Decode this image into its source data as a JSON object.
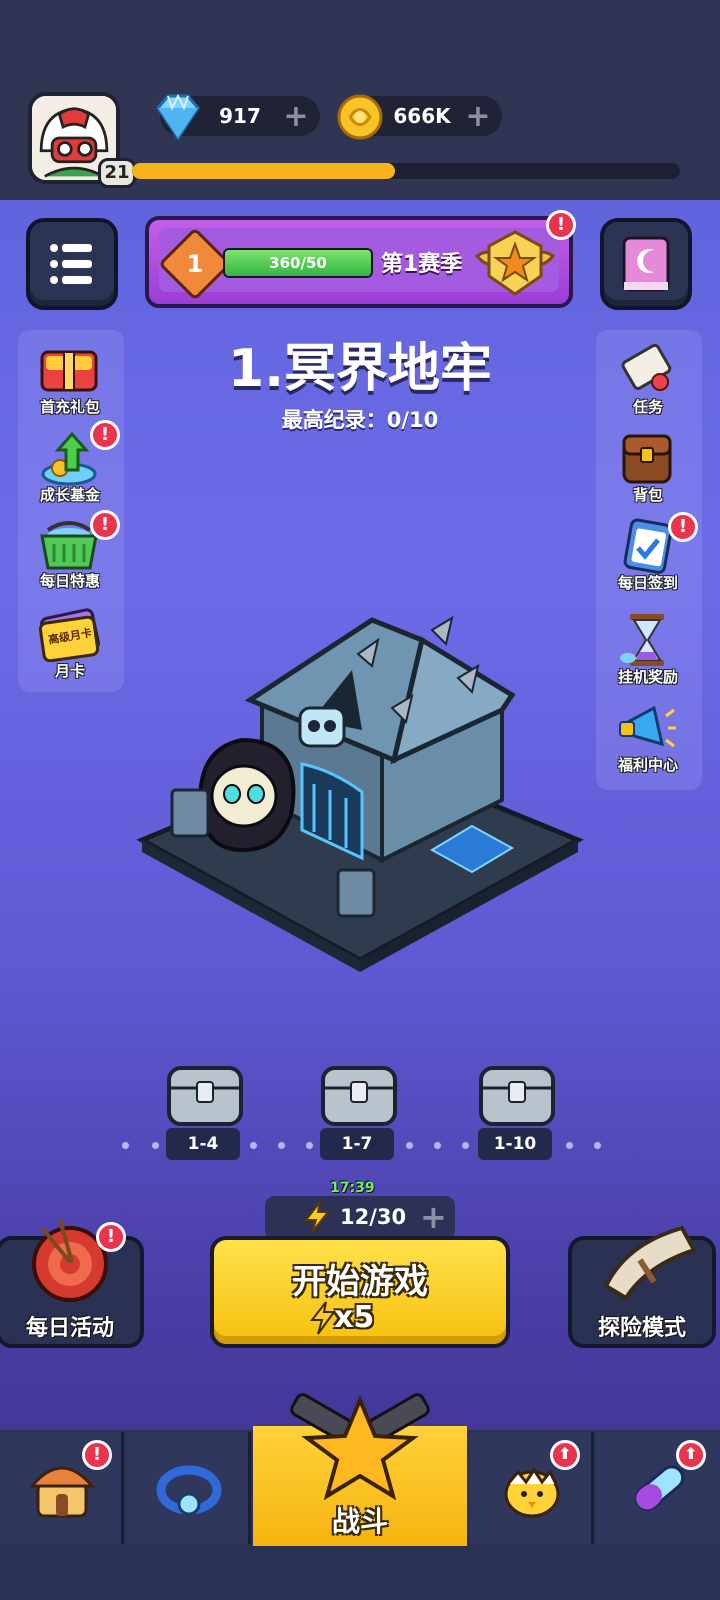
{
  "header": {
    "player_level": "21",
    "xp_progress_fraction": 0.48,
    "gems": "917",
    "coins": "666K",
    "plus_symbol": "+"
  },
  "season": {
    "rank": "1",
    "progress_text": "360/50",
    "label": "第1赛季",
    "alert": "!"
  },
  "stage": {
    "title": "1.冥界地牢",
    "record": "最高纪录：0/10"
  },
  "left_menu": [
    {
      "label": "首充礼包",
      "icon": "gift-box-icon"
    },
    {
      "label": "成长基金",
      "icon": "growth-fund-icon",
      "alert": "!"
    },
    {
      "label": "每日特惠",
      "icon": "basket-icon",
      "alert": "!"
    },
    {
      "label": "月卡",
      "icon": "monthly-card-icon",
      "tag": "高级月卡"
    }
  ],
  "right_menu": [
    {
      "label": "任务",
      "icon": "scroll-icon"
    },
    {
      "label": "背包",
      "icon": "backpack-icon"
    },
    {
      "label": "每日签到",
      "icon": "checkin-clipboard-icon",
      "alert": "!"
    },
    {
      "label": "挂机奖励",
      "icon": "hourglass-icon"
    },
    {
      "label": "福利中心",
      "icon": "megaphone-icon"
    }
  ],
  "chests": [
    {
      "label": "1-4"
    },
    {
      "label": "1-7"
    },
    {
      "label": "1-10"
    }
  ],
  "energy": {
    "timer": "17:39",
    "value": "12/30"
  },
  "actions": {
    "start_label": "开始游戏",
    "start_cost": "x5",
    "daily_label": "每日活动",
    "adventure_label": "探险模式"
  },
  "bottom_nav": {
    "fight_label": "战斗",
    "up_symbol": "⬆"
  },
  "colors": {
    "accent_yellow": "#f7c10f",
    "alert_red": "#e8344d",
    "panel_dark": "#2a3152"
  }
}
